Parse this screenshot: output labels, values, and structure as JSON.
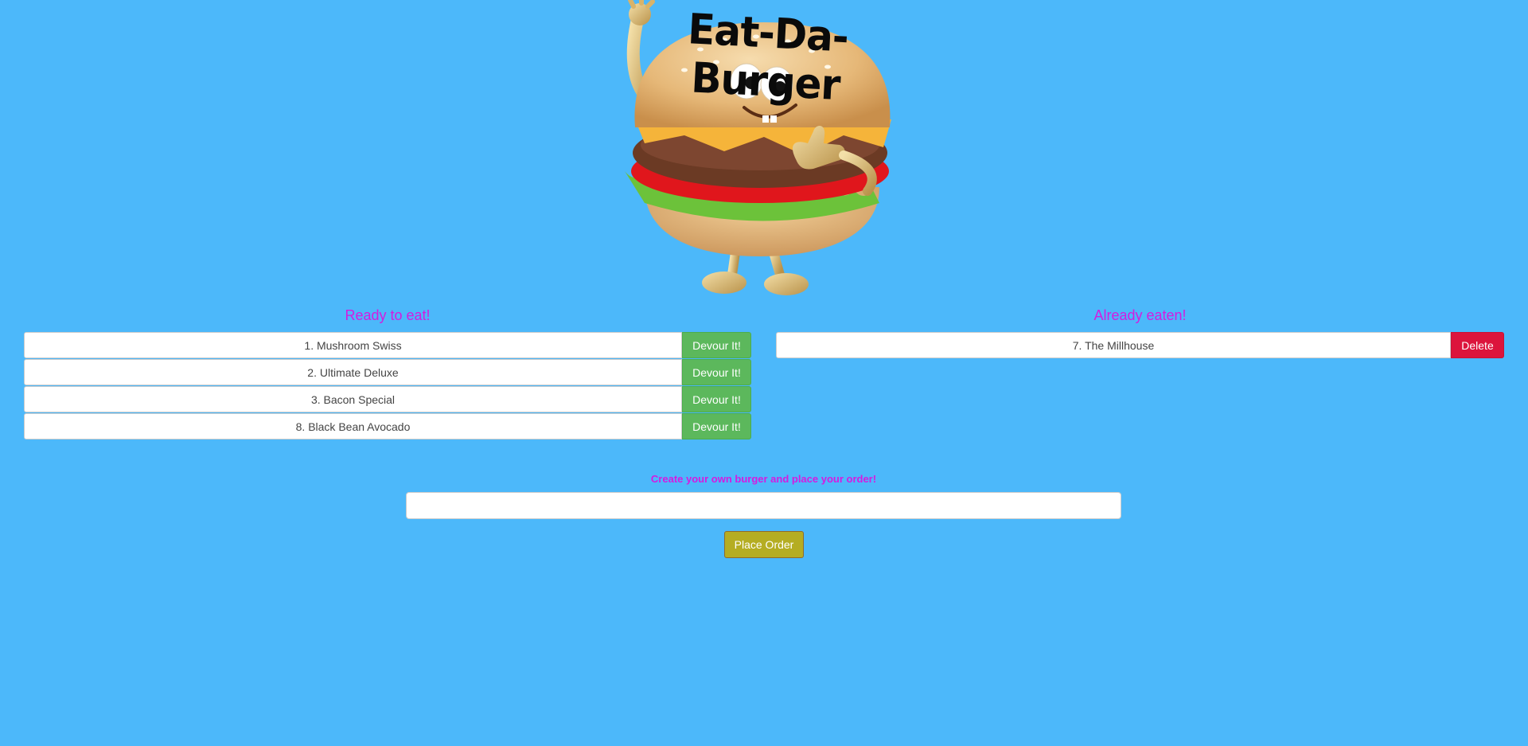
{
  "header": {
    "logo_text": "Eat-Da-Burger",
    "logo_icon": "burger-mascot-icon"
  },
  "ready": {
    "heading": "Ready to eat!",
    "items": [
      {
        "name": "1. Mushroom Swiss",
        "button": "Devour It!"
      },
      {
        "name": "2. Ultimate Deluxe",
        "button": "Devour It!"
      },
      {
        "name": "3. Bacon Special",
        "button": "Devour It!"
      },
      {
        "name": "8. Black Bean Avocado",
        "button": "Devour It!"
      }
    ]
  },
  "eaten": {
    "heading": "Already eaten!",
    "items": [
      {
        "name": "7. The Millhouse",
        "button": "Delete"
      }
    ]
  },
  "order_form": {
    "label": "Create your own burger and place your order!",
    "input_value": "",
    "input_placeholder": "",
    "submit_label": "Place Order"
  },
  "colors": {
    "background": "#4cb8fa",
    "heading": "#d41ce0",
    "devour": "#5cb85c",
    "delete": "#dc143c",
    "place_order": "#b5ad22"
  }
}
